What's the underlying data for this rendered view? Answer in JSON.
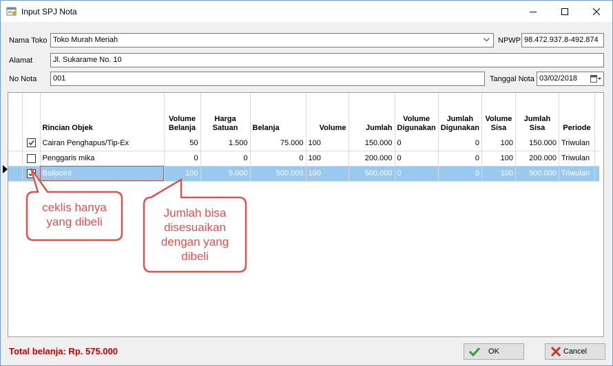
{
  "window": {
    "title": "Input SPJ Nota"
  },
  "form": {
    "nama_toko_label": "Nama Toko",
    "nama_toko_value": "Toko Murah Meriah",
    "npwp_label": "NPWP",
    "npwp_value": "98.472.937.8-492.874",
    "alamat_label": "Alamat",
    "alamat_value": "Jl. Sukarame No. 10",
    "no_nota_label": "No Nota",
    "no_nota_value": "001",
    "tanggal_nota_label": "Tanggal Nota",
    "tanggal_nota_value": "03/02/2018"
  },
  "grid": {
    "columns": [
      "",
      "Rincian Objek",
      "Volume Belanja",
      "Harga Satuan",
      "Belanja",
      "Volume",
      "Jumlah",
      "Volume Digunakan",
      "Jumlah Digunakan",
      "Volume Sisa",
      "Jumlah Sisa",
      "Periode"
    ],
    "rows": [
      {
        "checked": true,
        "rincian": "Cairan Penghapus/Tip-Ex",
        "volume_belanja": "50",
        "harga_satuan": "1.500",
        "belanja": "75.000",
        "volume": "100",
        "jumlah": "150.000",
        "volume_digunakan": "0",
        "jumlah_digunakan": "0",
        "volume_sisa": "100",
        "jumlah_sisa": "150.000",
        "periode": "Triwulan"
      },
      {
        "checked": false,
        "rincian": "Penggaris mika",
        "volume_belanja": "0",
        "harga_satuan": "0",
        "belanja": "0",
        "volume": "100",
        "jumlah": "200.000",
        "volume_digunakan": "0",
        "jumlah_digunakan": "0",
        "volume_sisa": "100",
        "jumlah_sisa": "200.000",
        "periode": "Triwulan"
      },
      {
        "checked": true,
        "rincian": "Ballpoint",
        "volume_belanja": "100",
        "harga_satuan": "5.000",
        "belanja": "500.000",
        "volume": "100",
        "jumlah": "500.000",
        "volume_digunakan": "0",
        "jumlah_digunakan": "0",
        "volume_sisa": "100",
        "jumlah_sisa": "500.000",
        "periode": "Triwulan"
      }
    ]
  },
  "callouts": {
    "checkbox_note": "ceklis hanya yang dibeli",
    "jumlah_note": "Jumlah bisa disesuaikan dengan yang dibeli"
  },
  "footer": {
    "total_text": "Total belanja: Rp. 575.000",
    "ok_label": "OK",
    "cancel_label": "Cancel"
  },
  "colors": {
    "selection": "#99c9ef",
    "callout": "#d9534f",
    "total": "#c00000"
  }
}
